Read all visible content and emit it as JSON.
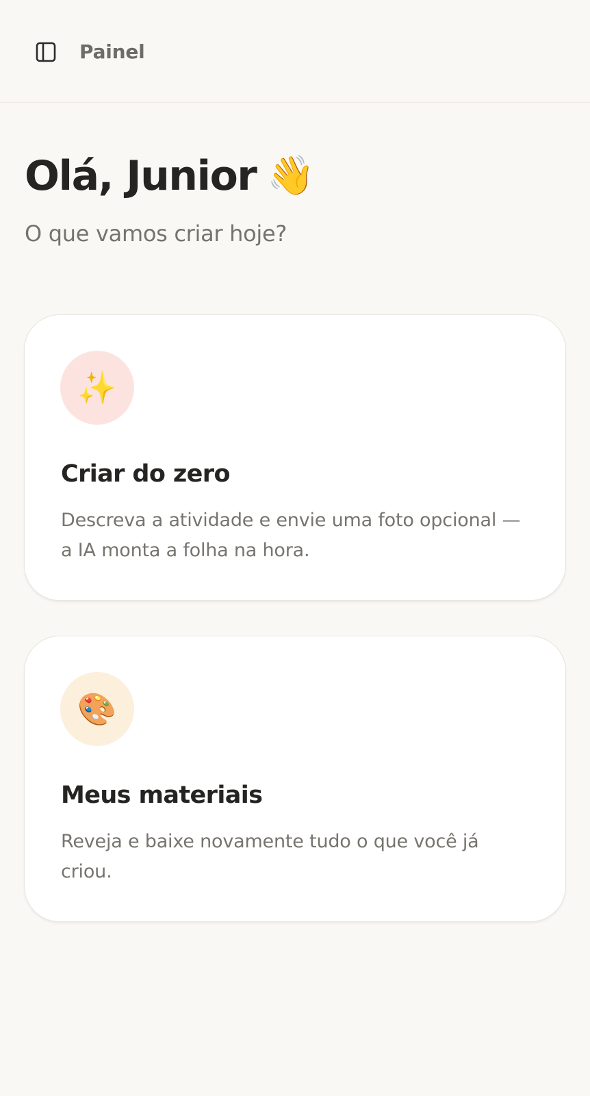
{
  "topbar": {
    "toggle_icon": "sidebar-panel-icon",
    "title": "Painel"
  },
  "greeting": {
    "text": "Olá, Junior",
    "emoji": "👋"
  },
  "subtitle": "O que vamos criar hoje?",
  "cards": [
    {
      "icon": "✨",
      "icon_name": "sparkles-icon",
      "icon_bg": "#fde3df",
      "title": "Criar do zero",
      "description": "Descreva a atividade e envie uma foto opcional — a IA monta a folha na hora."
    },
    {
      "icon": "🎨",
      "icon_name": "palette-icon",
      "icon_bg": "#fcefdc",
      "title": "Meus materiais",
      "description": "Reveja e baixe novamente tudo o que você já criou."
    }
  ],
  "colors": {
    "background": "#faf8f5",
    "card": "#ffffff",
    "text_primary": "#252422",
    "text_secondary": "#757370"
  }
}
